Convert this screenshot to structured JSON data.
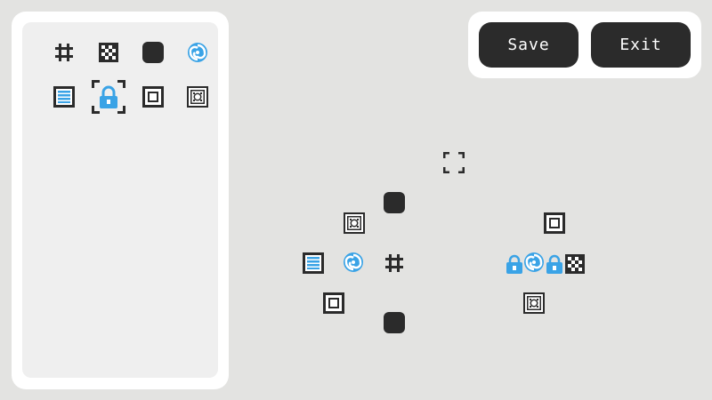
{
  "colors": {
    "dark": "#2b2b2b",
    "accent": "#3aa3e6",
    "panel": "#ffffff",
    "background": "#e3e3e1"
  },
  "toolbar": {
    "save_label": "Save",
    "exit_label": "Exit"
  },
  "palette": {
    "tiles": [
      {
        "icon": "hash-icon"
      },
      {
        "icon": "checker-icon"
      },
      {
        "icon": "dark-block-icon"
      },
      {
        "icon": "swirl-icon"
      },
      {
        "icon": "striped-panel-icon"
      },
      {
        "icon": "lock-icon",
        "selected": true
      },
      {
        "icon": "square-frame-icon"
      },
      {
        "icon": "ornate-frame-icon"
      }
    ]
  },
  "board": {
    "pieces": [
      {
        "icon": "corner-brackets-icon"
      },
      {
        "icon": "dark-block-icon"
      },
      {
        "icon": "ornate-frame-icon"
      },
      {
        "icon": "striped-panel-icon"
      },
      {
        "icon": "swirl-icon"
      },
      {
        "icon": "hash-icon"
      },
      {
        "icon": "square-frame-icon"
      },
      {
        "icon": "dark-block-icon"
      },
      {
        "icon": "square-frame-icon"
      },
      {
        "icon": "lock-icon"
      },
      {
        "icon": "swirl-icon"
      },
      {
        "icon": "lock-icon"
      },
      {
        "icon": "checker-icon"
      },
      {
        "icon": "ornate-frame-icon"
      }
    ]
  }
}
